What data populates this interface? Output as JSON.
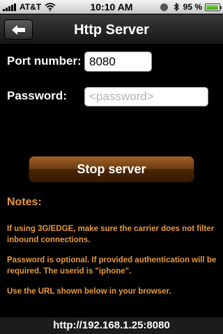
{
  "status_bar": {
    "carrier": "AT&T",
    "time": "10:10 AM",
    "battery_percent": "95 %",
    "battery_level": 0.95,
    "icons": [
      "signal-icon",
      "wifi-icon",
      "rotation-lock-icon",
      "bluetooth-icon",
      "battery-icon"
    ]
  },
  "nav": {
    "title": "Http Server",
    "back_icon": "back-arrow-icon"
  },
  "form": {
    "port_label": "Port number:",
    "port_value": "8080",
    "password_label": "Password:",
    "password_placeholder": "<password>"
  },
  "actions": {
    "stop_label": "Stop server"
  },
  "notes": {
    "title": "Notes:",
    "items": [
      "If using 3G/EDGE, make sure the carrier does not filter inbound connections.",
      "Password is optional. If provided authentication will be required. The userid is \"iphone\".",
      "Use the URL shown below in your browser."
    ]
  },
  "url": "http://192.168.1.25:8080",
  "colors": {
    "accent": "#e89a3c",
    "button_brown": "#6a3a10",
    "background": "#000000"
  }
}
